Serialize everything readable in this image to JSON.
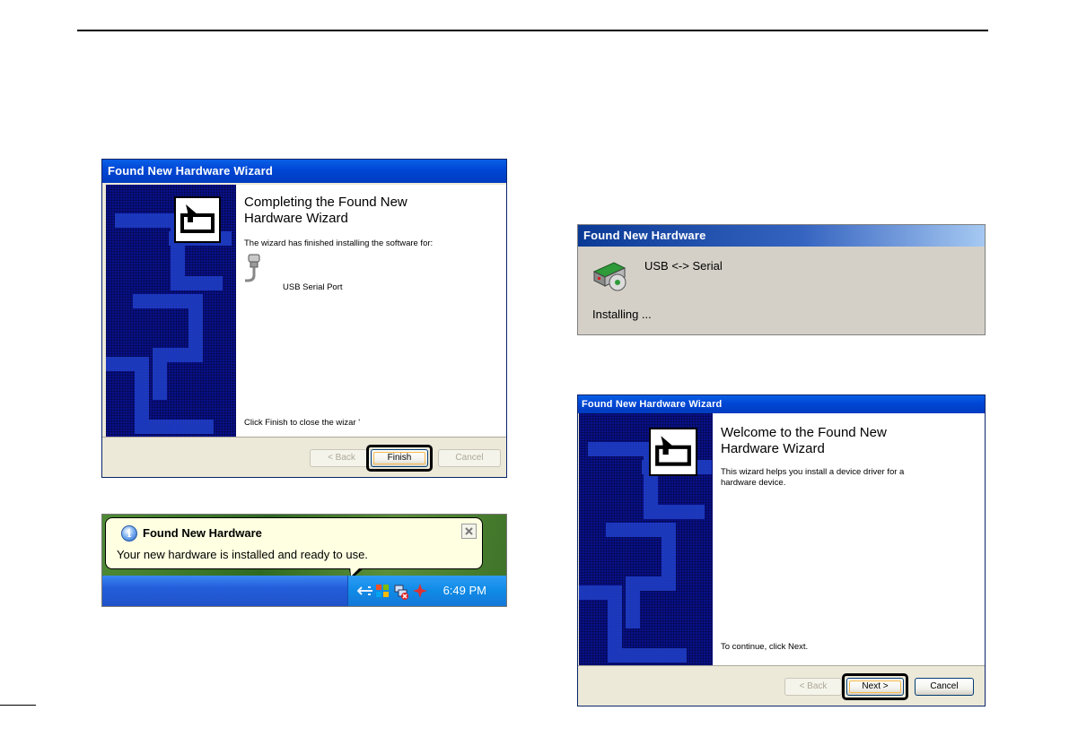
{
  "wizard_complete": {
    "title": "Found New Hardware Wizard",
    "heading_line1": "Completing the Found New",
    "heading_line2": "Hardware Wizard",
    "description": "The wizard has finished installing the software for:",
    "device_name": "USB Serial Port",
    "footer_text": "Click Finish to close the wizar '",
    "back_label": "< Back",
    "finish_label": "Finish",
    "cancel_label": "Cancel"
  },
  "balloon": {
    "title": "Found New Hardware",
    "message": "Your new hardware is installed and ready to use.",
    "clock": "6:49 PM"
  },
  "installing_popup": {
    "title": "Found New Hardware",
    "device_name": "USB <-> Serial",
    "status": "Installing ..."
  },
  "wizard_welcome": {
    "title": "Found New Hardware Wizard",
    "heading_line1": "Welcome to the Found New",
    "heading_line2": "Hardware Wizard",
    "description_line1": "This wizard helps you install a device driver for a",
    "description_line2": "hardware device.",
    "footer_text": "To continue, click Next.",
    "back_label": "< Back",
    "next_label": "Next >",
    "cancel_label": "Cancel"
  },
  "colors": {
    "title_blue": "#0046d5",
    "side_panel": "#08108a",
    "balloon_bg": "#ffffe1",
    "focus_orange": "#f6b94a"
  }
}
